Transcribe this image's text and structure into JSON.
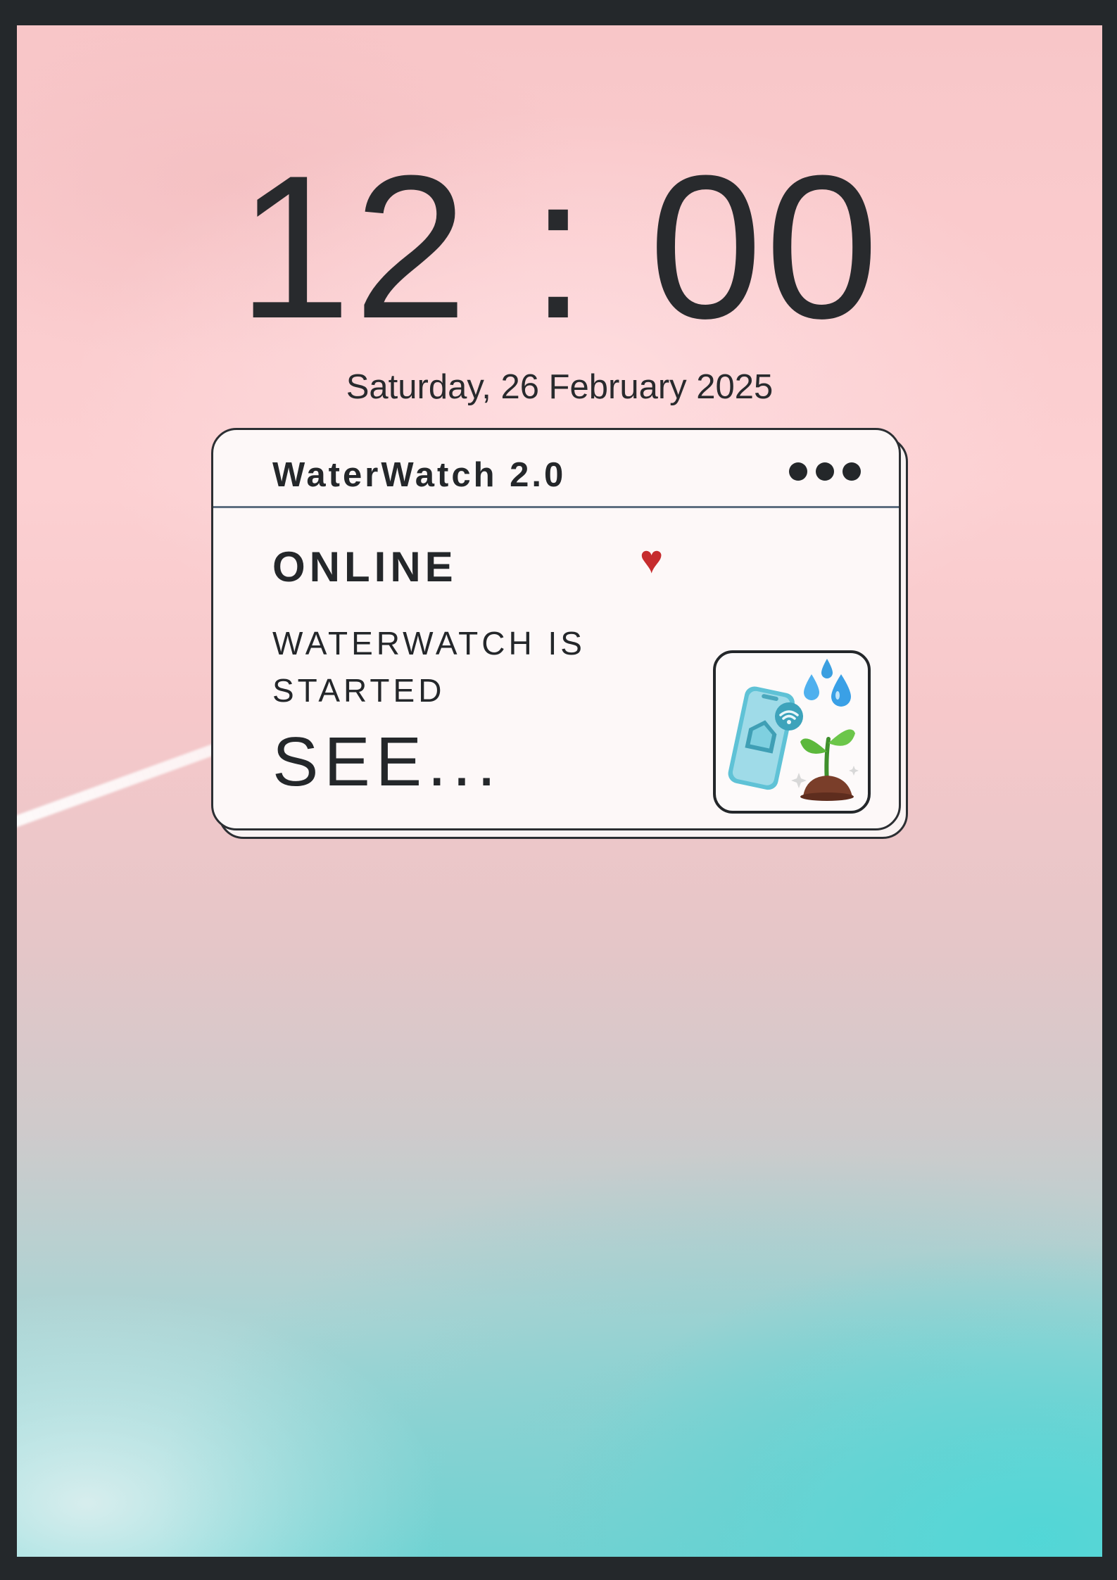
{
  "lockscreen": {
    "time": "12 : 00",
    "date": "Saturday, 26 February 2025"
  },
  "notification": {
    "app_name": "WaterWatch 2.0",
    "menu_icon": "more-dots-icon",
    "status": "ONLINE",
    "status_icon": "heart-icon",
    "message": "WATERWATCH IS STARTED",
    "action_text": "SEE...",
    "app_icon": "phone-water-plant-icon"
  },
  "colors": {
    "text": "#24272a",
    "heart": "#c62c2e",
    "card_background": "#fdf8f8",
    "divider": "#5d6f80"
  }
}
